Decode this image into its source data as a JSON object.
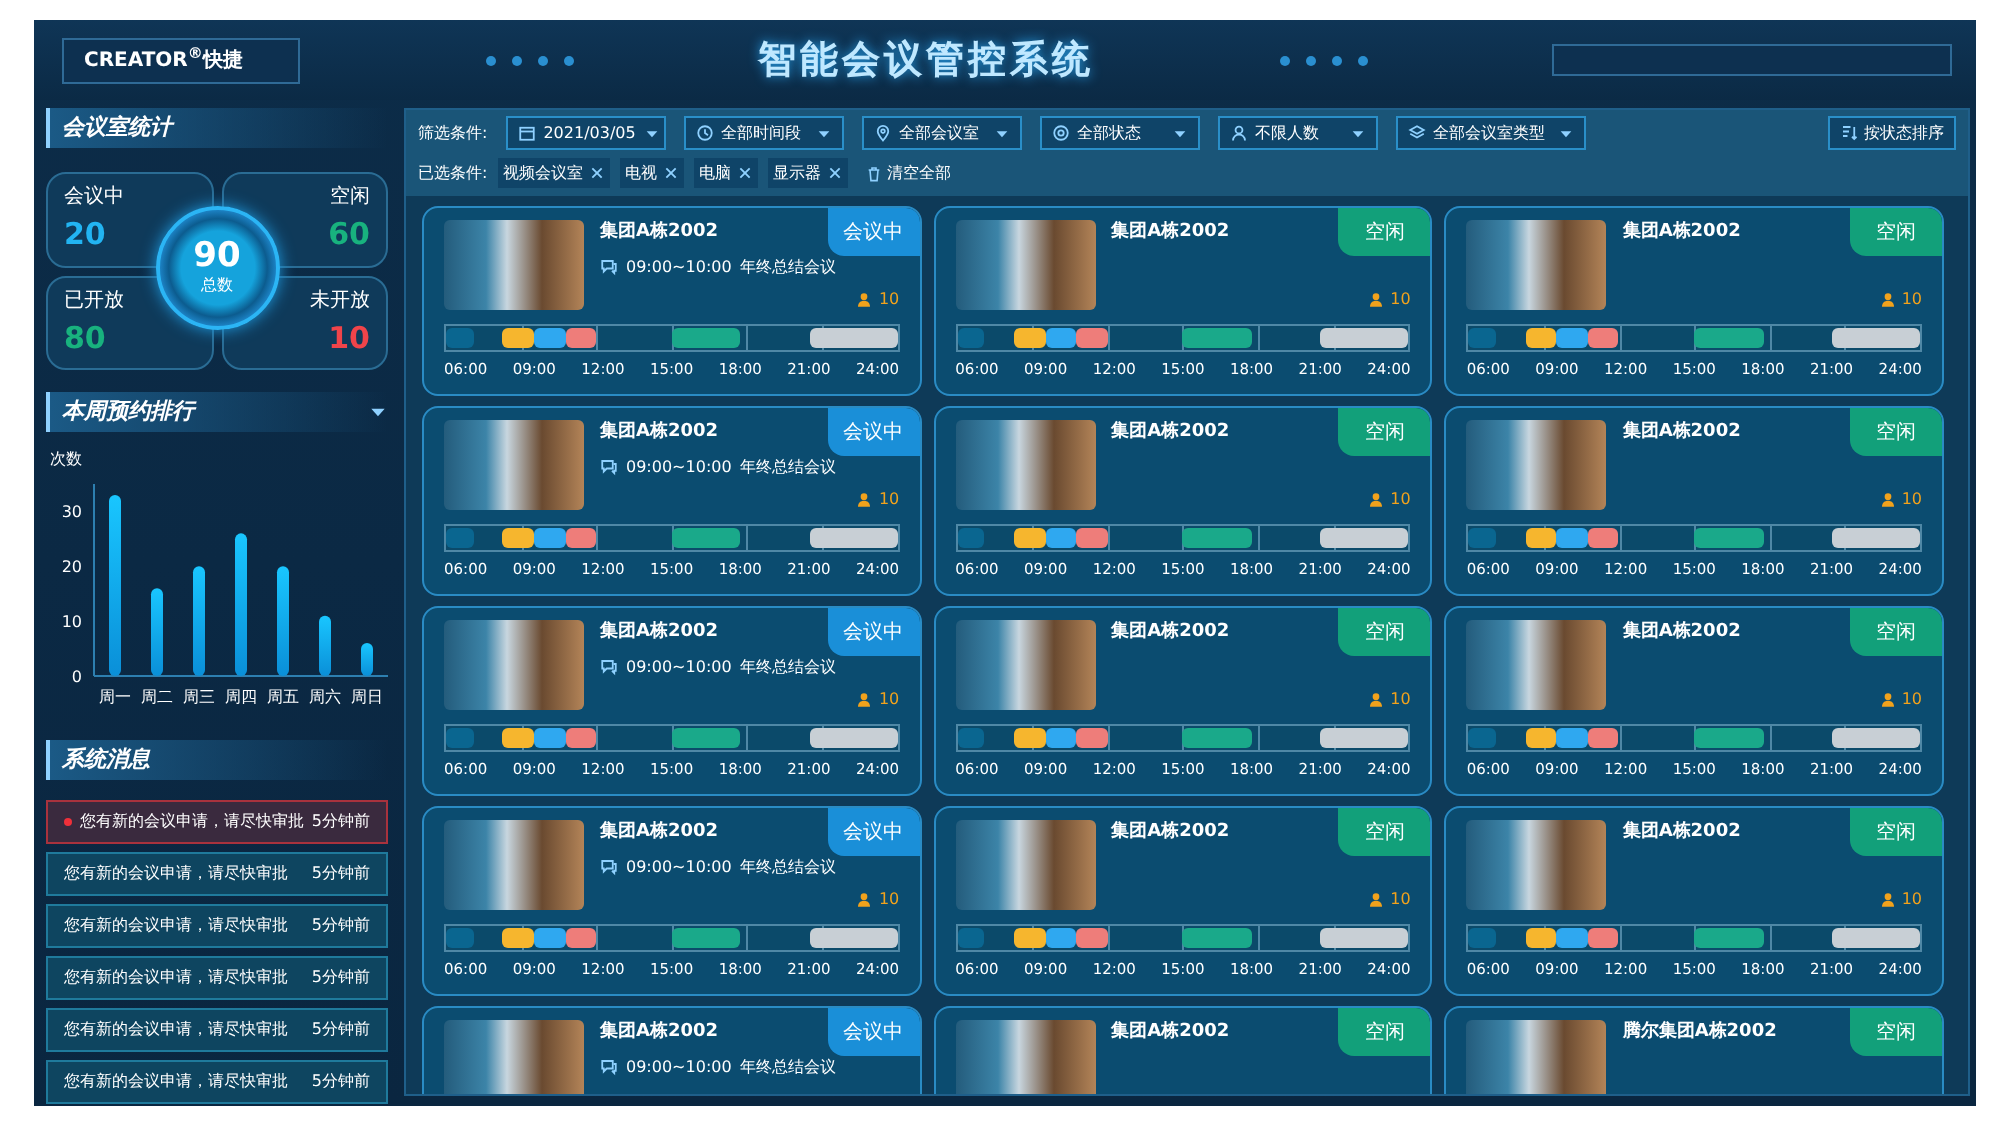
{
  "header": {
    "logo": "CREATOR$^{®}$快捷",
    "title": "智能会议管控系统"
  },
  "stats": {
    "title": "会议室统计",
    "total": {
      "value": "90",
      "label": "总数"
    },
    "items": [
      {
        "label": "会议中",
        "value": "20",
        "color": "#22b4f2"
      },
      {
        "label": "空闲",
        "value": "60",
        "color": "#18b27e"
      },
      {
        "label": "已开放",
        "value": "80",
        "color": "#18b27e"
      },
      {
        "label": "未开放",
        "value": "10",
        "color": "#f0444a"
      }
    ]
  },
  "ranking": {
    "title": "本周预约排行",
    "chart_data": {
      "type": "bar",
      "ylabel": "次数",
      "categories": [
        "周一",
        "周二",
        "周三",
        "周四",
        "周五",
        "周六",
        "周日"
      ],
      "values": [
        33,
        16,
        20,
        26,
        20,
        11,
        6
      ],
      "ylim": [
        0,
        35
      ],
      "yticks": [
        0,
        10,
        20,
        30
      ]
    }
  },
  "messages": {
    "title": "系统消息",
    "items": [
      {
        "text": "您有新的会议申请，请尽快审批",
        "time": "5分钟前",
        "unread": true
      },
      {
        "text": "您有新的会议申请，请尽快审批",
        "time": "5分钟前",
        "unread": false
      },
      {
        "text": "您有新的会议申请，请尽快审批",
        "time": "5分钟前",
        "unread": false
      },
      {
        "text": "您有新的会议申请，请尽快审批",
        "time": "5分钟前",
        "unread": false
      },
      {
        "text": "您有新的会议申请，请尽快审批",
        "time": "5分钟前",
        "unread": false
      },
      {
        "text": "您有新的会议申请，请尽快审批",
        "time": "5分钟前",
        "unread": false
      }
    ]
  },
  "filters": {
    "label": "筛选条件:",
    "items": [
      {
        "kind": "date",
        "value": "2021/03/05"
      },
      {
        "kind": "time",
        "value": "全部时间段"
      },
      {
        "kind": "room",
        "value": "全部会议室"
      },
      {
        "kind": "status",
        "value": "全部状态"
      },
      {
        "kind": "people",
        "value": "不限人数"
      },
      {
        "kind": "type",
        "value": "全部会议室类型"
      }
    ],
    "sort_button": "按状态排序",
    "selected_label": "已选条件:",
    "tags": [
      "视频会议室",
      "电视",
      "电脑",
      "显示器"
    ],
    "clear": "清空全部"
  },
  "rooms": [
    {
      "title": "集团A栋2002",
      "status": {
        "label": "会议中",
        "kind": "busy"
      },
      "schedule": {
        "time": "09:00~10:00",
        "subject": "年终总结会议"
      },
      "capacity": "10",
      "ticks": [
        "06:00",
        "09:00",
        "12:00",
        "15:00",
        "18:00",
        "21:00",
        "24:00"
      ]
    },
    {
      "title": "集团A栋2002",
      "status": {
        "label": "空闲",
        "kind": "free"
      },
      "capacity": "10",
      "ticks": [
        "06:00",
        "09:00",
        "12:00",
        "15:00",
        "18:00",
        "21:00",
        "24:00"
      ]
    },
    {
      "title": "集团A栋2002",
      "status": {
        "label": "空闲",
        "kind": "free"
      },
      "capacity": "10",
      "ticks": [
        "06:00",
        "09:00",
        "12:00",
        "15:00",
        "18:00",
        "21:00",
        "24:00"
      ]
    },
    {
      "title": "集团A栋2002",
      "status": {
        "label": "会议中",
        "kind": "busy"
      },
      "schedule": {
        "time": "09:00~10:00",
        "subject": "年终总结会议"
      },
      "capacity": "10",
      "ticks": [
        "06:00",
        "09:00",
        "12:00",
        "15:00",
        "18:00",
        "21:00",
        "24:00"
      ]
    },
    {
      "title": "集团A栋2002",
      "status": {
        "label": "空闲",
        "kind": "free"
      },
      "capacity": "10",
      "ticks": [
        "06:00",
        "09:00",
        "12:00",
        "15:00",
        "18:00",
        "21:00",
        "24:00"
      ]
    },
    {
      "title": "集团A栋2002",
      "status": {
        "label": "空闲",
        "kind": "free"
      },
      "capacity": "10",
      "ticks": [
        "06:00",
        "09:00",
        "12:00",
        "15:00",
        "18:00",
        "21:00",
        "24:00"
      ]
    },
    {
      "title": "集团A栋2002",
      "status": {
        "label": "会议中",
        "kind": "busy"
      },
      "schedule": {
        "time": "09:00~10:00",
        "subject": "年终总结会议"
      },
      "capacity": "10",
      "ticks": [
        "06:00",
        "09:00",
        "12:00",
        "15:00",
        "18:00",
        "21:00",
        "24:00"
      ]
    },
    {
      "title": "集团A栋2002",
      "status": {
        "label": "空闲",
        "kind": "free"
      },
      "capacity": "10",
      "ticks": [
        "06:00",
        "09:00",
        "12:00",
        "15:00",
        "18:00",
        "21:00",
        "24:00"
      ]
    },
    {
      "title": "集团A栋2002",
      "status": {
        "label": "空闲",
        "kind": "free"
      },
      "capacity": "10",
      "ticks": [
        "06:00",
        "09:00",
        "12:00",
        "15:00",
        "18:00",
        "21:00",
        "24:00"
      ]
    },
    {
      "title": "集团A栋2002",
      "status": {
        "label": "会议中",
        "kind": "busy"
      },
      "schedule": {
        "time": "09:00~10:00",
        "subject": "年终总结会议"
      },
      "capacity": "10",
      "ticks": [
        "06:00",
        "09:00",
        "12:00",
        "15:00",
        "18:00",
        "21:00",
        "24:00"
      ]
    },
    {
      "title": "集团A栋2002",
      "status": {
        "label": "空闲",
        "kind": "free"
      },
      "capacity": "10",
      "ticks": [
        "06:00",
        "09:00",
        "12:00",
        "15:00",
        "18:00",
        "21:00",
        "24:00"
      ]
    },
    {
      "title": "集团A栋2002",
      "status": {
        "label": "空闲",
        "kind": "free"
      },
      "capacity": "10",
      "ticks": [
        "06:00",
        "09:00",
        "12:00",
        "15:00",
        "18:00",
        "21:00",
        "24:00"
      ]
    },
    {
      "title": "集团A栋2002",
      "status": {
        "label": "会议中",
        "kind": "busy"
      },
      "schedule": {
        "time": "09:00~10:00",
        "subject": "年终总结会议"
      }
    },
    {
      "title": "集团A栋2002",
      "status": {
        "label": "空闲",
        "kind": "free"
      }
    },
    {
      "title": "腾尔集团A栋2002",
      "status": {
        "label": "空闲",
        "kind": "free"
      }
    }
  ]
}
